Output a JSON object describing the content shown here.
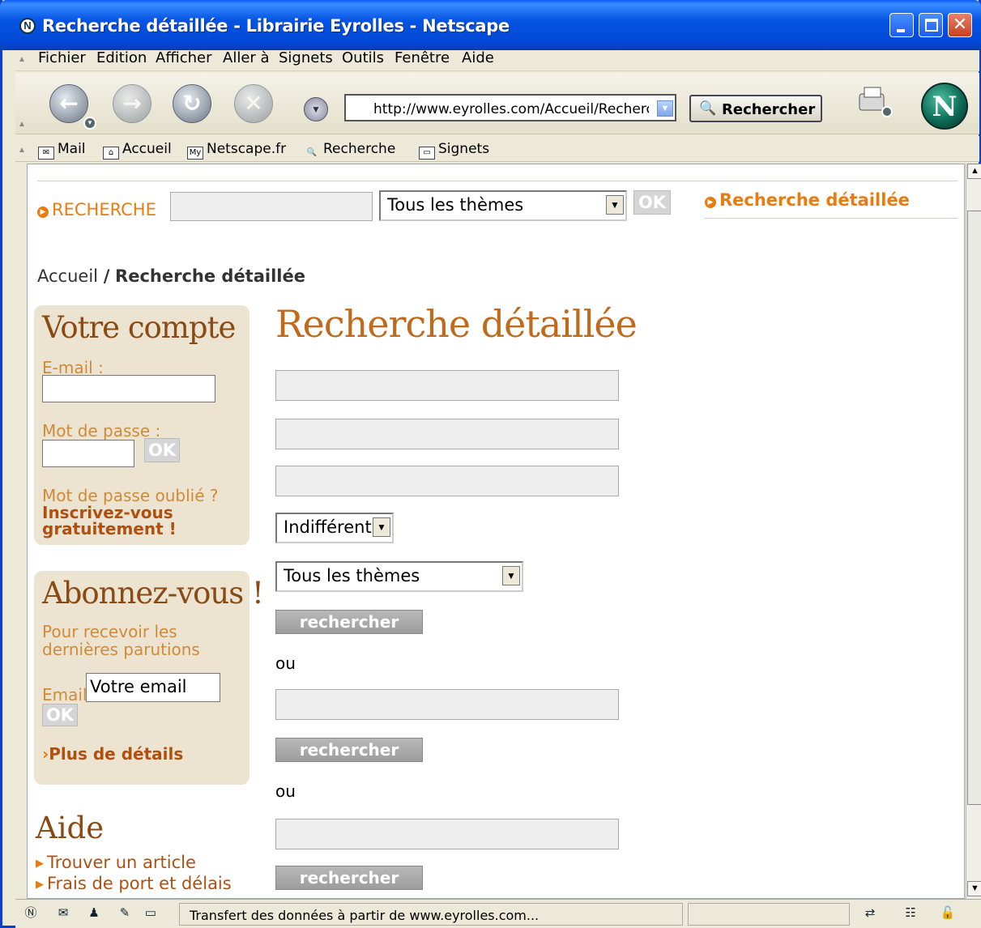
{
  "window": {
    "title": "Recherche détaillée - Librairie Eyrolles - Netscape"
  },
  "menu": [
    "Fichier",
    "Edition",
    "Afficher",
    "Aller à",
    "Signets",
    "Outils",
    "Fenêtre",
    "Aide"
  ],
  "nav": {
    "url": "http://www.eyrolles.com/Accueil/Recherche",
    "search_button": "Rechercher"
  },
  "personal_toolbar": [
    "Mail",
    "Accueil",
    "Netscape.fr",
    "Recherche",
    "Signets"
  ],
  "page": {
    "top_search_label": "RECHERCHE",
    "top_theme_select": "Tous les thèmes",
    "top_ok": "OK",
    "detailed_search_link": "Recherche détaillée",
    "breadcrumb_home": "Accueil",
    "breadcrumb_sep": "/",
    "breadcrumb_current": "Recherche détaillée",
    "main_title": "Recherche détaillée",
    "select_indifferent": "Indifférent",
    "select_theme": "Tous les thèmes",
    "search_button": "rechercher",
    "or_label": "ou"
  },
  "account": {
    "title": "Votre compte",
    "email_label": "E-mail :",
    "password_label": "Mot de passe :",
    "ok": "OK",
    "forgot": "Mot de passe oublié ?",
    "register_line1": "Inscrivez-vous",
    "register_line2": "gratuitement !"
  },
  "subscribe": {
    "title": "Abonnez-vous !",
    "desc_line1": "Pour recevoir les",
    "desc_line2": "dernières parutions",
    "email_label": "Email",
    "email_value": "Votre email",
    "ok": "OK",
    "more": "Plus de détails"
  },
  "help": {
    "title": "Aide",
    "links": [
      "Trouver un article",
      "Frais de port et délais"
    ]
  },
  "status": {
    "text": "Transfert des données à partir de www.eyrolles.com..."
  }
}
